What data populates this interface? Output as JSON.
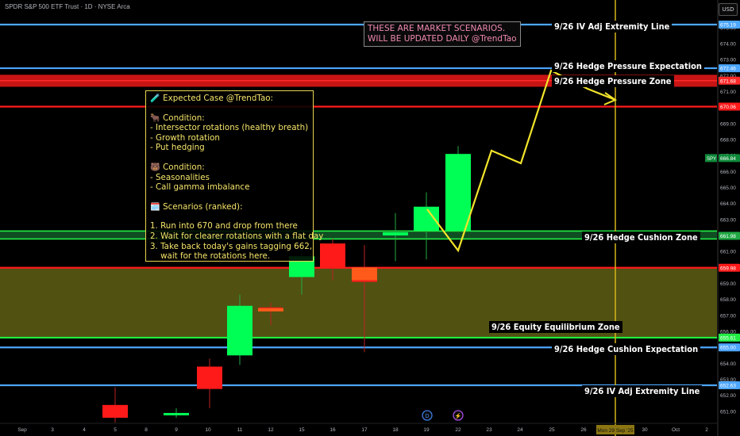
{
  "header": {
    "title": "SPDR S&P 500 ETF Trust · 1D · NYSE Arca",
    "currency": "USD"
  },
  "notice": {
    "line1": "THESE ARE MARKET SCENARIOS.",
    "line2": "WILL BE UPDATED DAILY @TrendTao"
  },
  "card": {
    "title": "🧪 Expected Case @TrendTao:",
    "bull_heading": "🐂 Condition:",
    "bull_items": [
      "- Intersector rotations (healthy breath)",
      "- Growth rotation",
      "- Put hedging"
    ],
    "bear_heading": "🐻 Condition:",
    "bear_items": [
      "- Seasonalities",
      "- Call gamma imbalance"
    ],
    "scen_heading": "🗓️ Scenarios (ranked):",
    "scen_items": [
      "1. Run into 670 and drop from there",
      "2. Wait for clearer rotations with a flat day",
      "3. Take back today's gains tagging 662,",
      "    wait for the rotations here."
    ]
  },
  "levels": {
    "iv_high": "9/26 IV Adj Extremity Line",
    "hp_expect": "9/26 Hedge Pressure Expectation",
    "hp_zone": "9/26 Hedge Pressure Zone",
    "hc_zone": "9/26 Hedge Cushion Zone",
    "eq_zone": "9/26 Equity Equilibrium Zone",
    "hc_expect": "9/26 Hedge Cushion Expectation",
    "iv_low": "9/26 IV Adj Extremity Line"
  },
  "colors": {
    "bg": "#000000",
    "bull": "#00ff55",
    "bear": "#ff1a1a",
    "blue_line": "#4da6ff",
    "red_line": "#ff1a1a",
    "green_line": "#22ee44",
    "zone_fill": "#5a5a14",
    "scenario": "#f2e42a",
    "cursor": "#d4b51a"
  },
  "chart_data": {
    "type": "candlestick",
    "symbol": "SPY",
    "timeframe": "1D",
    "ylim": [
      650.5,
      676.2
    ],
    "y_ticks": [
      "651.00",
      "652.00",
      "653.00",
      "654.00",
      "655.00",
      "656.00",
      "657.00",
      "658.00",
      "659.00",
      "660.00",
      "661.00",
      "662.00",
      "663.00",
      "664.00",
      "665.00",
      "666.00",
      "667.00",
      "668.00",
      "669.00",
      "670.00",
      "671.00",
      "672.00",
      "673.00",
      "674.00",
      "675.00"
    ],
    "x_ticks": [
      "Sep",
      "3",
      "4",
      "5",
      "8",
      "9",
      "10",
      "11",
      "12",
      "15",
      "16",
      "17",
      "18",
      "19",
      "22",
      "23",
      "24",
      "25",
      "26",
      "Mon 29 Sep '25",
      "30",
      "Oct",
      "2"
    ],
    "candles": [
      {
        "date": "5",
        "open": 651.4,
        "close": 650.6,
        "high": 652.5,
        "low": 650.3
      },
      {
        "date": "9",
        "open": 650.8,
        "close": 650.9,
        "high": 651.2,
        "low": 650.6
      },
      {
        "date": "10",
        "open": 653.8,
        "close": 652.4,
        "high": 654.3,
        "low": 651.2
      },
      {
        "date": "11",
        "open": 654.5,
        "close": 657.6,
        "high": 658.3,
        "low": 653.9
      },
      {
        "date": "12",
        "open": 657.5,
        "close": 657.3,
        "high": 657.8,
        "low": 656.4
      },
      {
        "date": "15",
        "open": 659.4,
        "close": 660.7,
        "high": 661.3,
        "low": 658.3
      },
      {
        "date": "16",
        "open": 661.5,
        "close": 660.0,
        "high": 661.8,
        "low": 659.2
      },
      {
        "date": "17",
        "open": 660.0,
        "close": 659.1,
        "high": 661.4,
        "low": 654.7
      },
      {
        "date": "18",
        "open": 662.0,
        "close": 662.2,
        "high": 663.4,
        "low": 660.4
      },
      {
        "date": "19",
        "open": 662.3,
        "close": 663.8,
        "high": 664.7,
        "low": 660.5
      },
      {
        "date": "22",
        "open": 662.3,
        "close": 667.1,
        "high": 667.6,
        "low": 662.2
      }
    ],
    "levels": [
      {
        "name": "9/26 IV Adj Extremity Line",
        "price": 675.19,
        "badge": "675.19"
      },
      {
        "name": "9/26 Hedge Pressure Expectation",
        "price": 672.46,
        "badge": "672.46"
      },
      {
        "name": "9/26 Hedge Pressure Zone",
        "price": 671.68,
        "badge": "671.68"
      },
      {
        "name": "red line",
        "price": 670.06,
        "badge": "670.06"
      },
      {
        "name": "SPY",
        "price": 666.84,
        "badge": "666.84"
      },
      {
        "name": "9/26 Hedge Cushion Zone",
        "price": 661.98,
        "badge": "661.98"
      },
      {
        "name": "zone top",
        "price": 659.98,
        "badge": "659.98"
      },
      {
        "name": "green line",
        "price": 655.61,
        "badge": "655.61"
      },
      {
        "name": "9/26 Hedge Cushion Expectation",
        "price": 655.0,
        "badge": "655.00"
      },
      {
        "name": "9/26 IV Adj Extremity Line",
        "price": 652.63,
        "badge": "652.63"
      }
    ]
  }
}
